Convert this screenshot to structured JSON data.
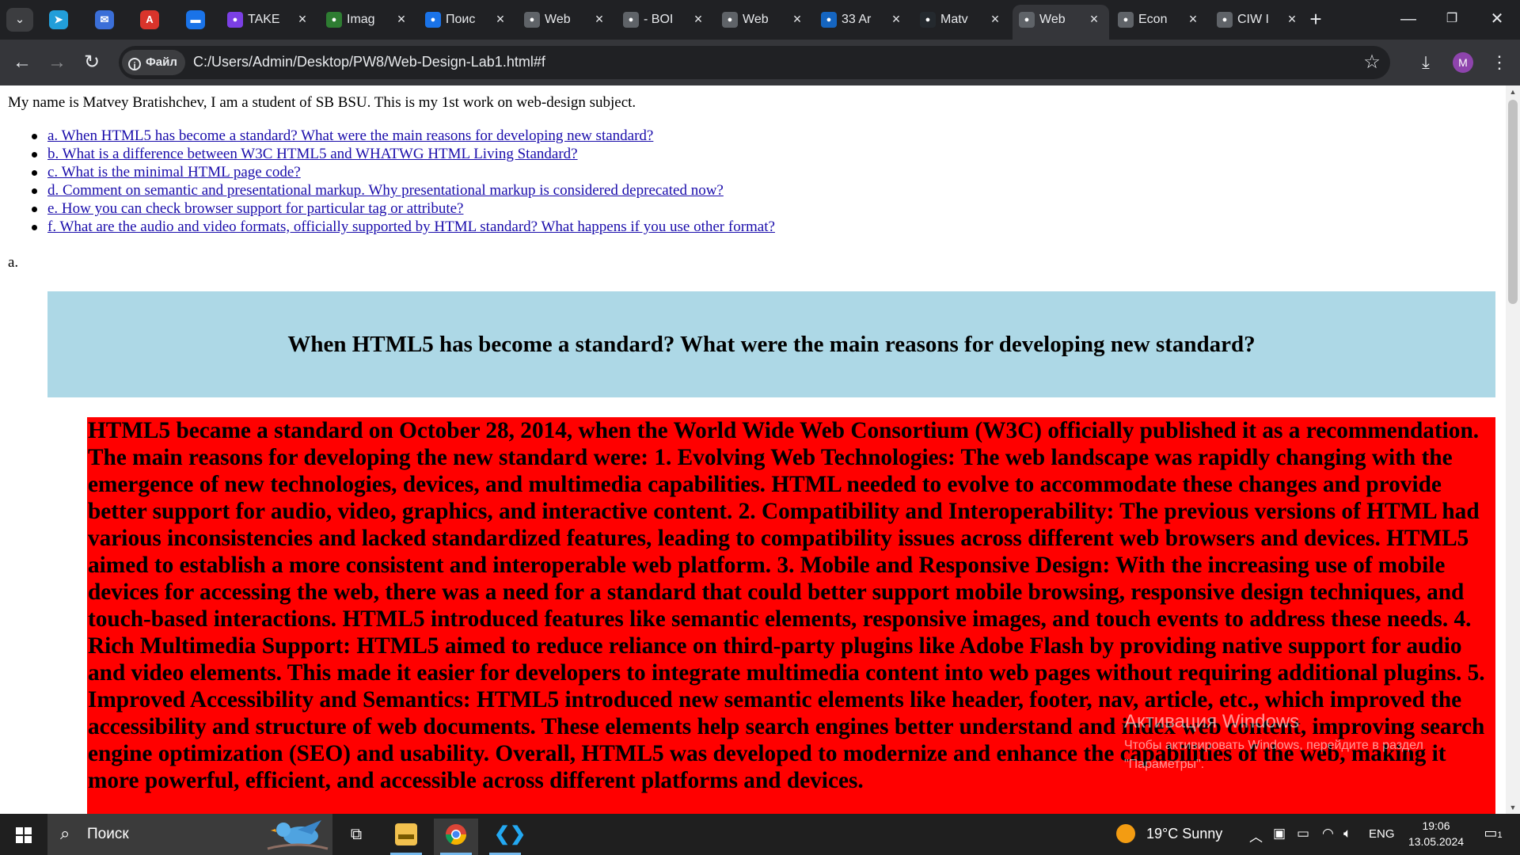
{
  "browser": {
    "tabs": [
      {
        "title": "TAKE",
        "favicon": "app-icon",
        "color": "#7b3fe4"
      },
      {
        "title": "Imag",
        "favicon": "image-app-icon",
        "color": "#2e7d32"
      },
      {
        "title": "Поис",
        "favicon": "mail-icon",
        "color": "#1a73e8"
      },
      {
        "title": "Web",
        "favicon": "document-icon",
        "color": "#5f6368"
      },
      {
        "title": "- BOI",
        "favicon": "globe-icon",
        "color": "#5f6368"
      },
      {
        "title": "Web",
        "favicon": "globe-icon",
        "color": "#5f6368"
      },
      {
        "title": "33 Ar",
        "favicon": "at-icon",
        "color": "#1565c0"
      },
      {
        "title": "Matv",
        "favicon": "github-icon",
        "color": "#24292e"
      },
      {
        "title": "Web",
        "favicon": "globe-icon",
        "color": "#5f6368",
        "active": true
      },
      {
        "title": "Econ",
        "favicon": "document-icon",
        "color": "#5f6368"
      },
      {
        "title": "CIW I",
        "favicon": "globe-icon",
        "color": "#5f6368"
      }
    ],
    "address": {
      "chip_label": "Файл",
      "url": "C:/Users/Admin/Desktop/PW8/Web-Design-Lab1.html#f"
    },
    "profile_initial": "M"
  },
  "page": {
    "intro": "My name is Matvey Bratishchev, I am a student of SB BSU. This is my 1st work on web-design subject.",
    "toc": [
      "a. When HTML5 has become a standard? What were the main reasons for developing new standard?",
      "b. What is a difference between W3C HTML5 and WHATWG HTML Living Standard?",
      "c. What is the minimal HTML page code?",
      "d. Comment on semantic and presentational markup. Why presentational markup is considered deprecated now?",
      "e. How you can check browser support for particular tag or attribute?",
      "f. What are the audio and video formats, officially supported by HTML standard? What happens if you use other format?"
    ],
    "section_marker": "a.",
    "question_heading": "When HTML5 has become a standard? What were the main reasons for developing new standard?",
    "answer": "HTML5 became a standard on October 28, 2014, when the World Wide Web Consortium (W3C) officially published it as a recommendation. The main reasons for developing the new standard were: 1. Evolving Web Technologies: The web landscape was rapidly changing with the emergence of new technologies, devices, and multimedia capabilities. HTML needed to evolve to accommodate these changes and provide better support for audio, video, graphics, and interactive content. 2. Compatibility and Interoperability: The previous versions of HTML had various inconsistencies and lacked standardized features, leading to compatibility issues across different web browsers and devices. HTML5 aimed to establish a more consistent and interoperable web platform. 3. Mobile and Responsive Design: With the increasing use of mobile devices for accessing the web, there was a need for a standard that could better support mobile browsing, responsive design techniques, and touch-based interactions. HTML5 introduced features like semantic elements, responsive images, and touch events to address these needs. 4. Rich Multimedia Support: HTML5 aimed to reduce reliance on third-party plugins like Adobe Flash by providing native support for audio and video elements. This made it easier for developers to integrate multimedia content into web pages without requiring additional plugins. 5. Improved Accessibility and Semantics: HTML5 introduced new semantic elements like header, footer, nav, article, etc., which improved the accessibility and structure of web documents. These elements help search engines better understand and index web content, improving search engine optimization (SEO) and usability. Overall, HTML5 was developed to modernize and enhance the capabilities of the web, making it more powerful, efficient, and accessible across different platforms and devices.",
    "heading_bg": "#add8e6",
    "answer_bg": "#ff0000"
  },
  "watermark": {
    "title": "Активация Windows",
    "subtitle": "Чтобы активировать Windows, перейдите в раздел \"Параметры\"."
  },
  "taskbar": {
    "search_label": "Поиск",
    "weather": "19°C  Sunny",
    "language": "ENG",
    "time": "19:06",
    "date": "13.05.2024",
    "notifications_count": "1"
  }
}
